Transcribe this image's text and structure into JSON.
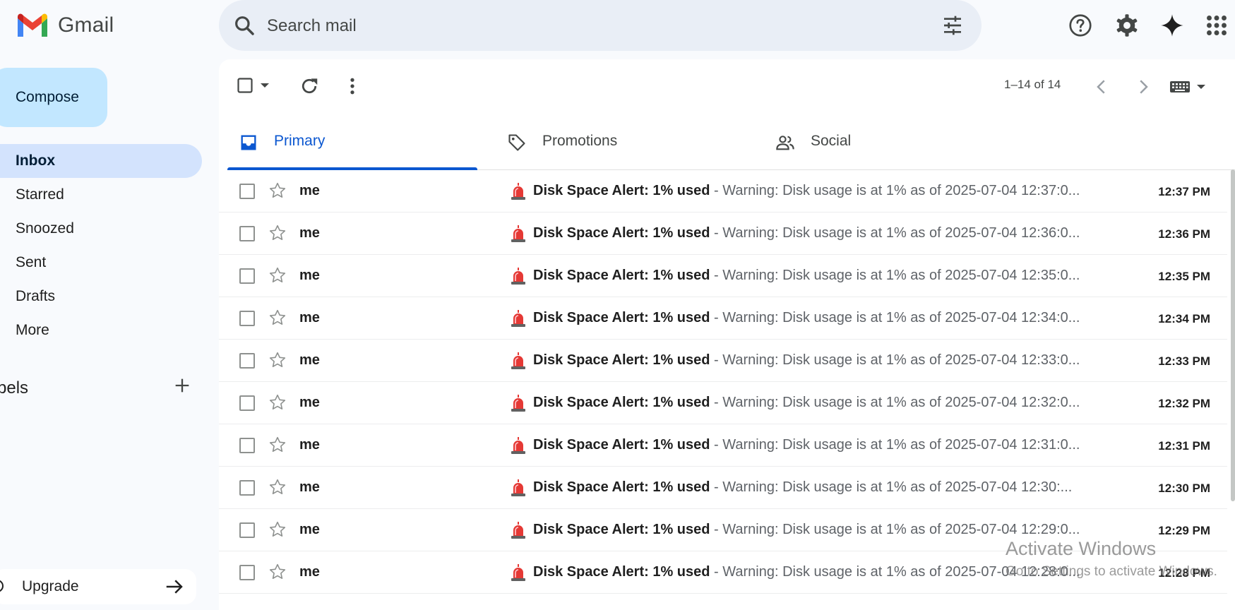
{
  "app": {
    "name": "Gmail"
  },
  "colors": {
    "accent": "#0b57d0",
    "compose_bg": "#c2e7ff",
    "active_nav_bg": "#d3e3fd",
    "siren": "#d93025"
  },
  "search": {
    "placeholder": "Search mail",
    "value": ""
  },
  "header_icons": [
    "search-icon",
    "tune-icon",
    "help-icon",
    "settings-icon",
    "gemini-icon",
    "apps-icon"
  ],
  "sidebar": {
    "compose_label": "Compose",
    "items": [
      {
        "label": "Inbox",
        "active": true
      },
      {
        "label": "Starred"
      },
      {
        "label": "Snoozed"
      },
      {
        "label": "Sent"
      },
      {
        "label": "Drafts"
      },
      {
        "label": "More"
      }
    ],
    "labels_heading": "bels",
    "upgrade_label": "Upgrade"
  },
  "toolbar": {
    "pager": "1–14 of 14"
  },
  "tabs": [
    {
      "label": "Primary",
      "active": true,
      "icon": "inbox-icon"
    },
    {
      "label": "Promotions",
      "icon": "tag-icon"
    },
    {
      "label": "Social",
      "icon": "people-icon"
    }
  ],
  "emails": [
    {
      "sender": "me",
      "subject": "Disk Space Alert: 1% used",
      "snippet": " - Warning: Disk usage is at 1% as of 2025-07-04 12:37:0...",
      "time": "12:37 PM"
    },
    {
      "sender": "me",
      "subject": "Disk Space Alert: 1% used",
      "snippet": " - Warning: Disk usage is at 1% as of 2025-07-04 12:36:0...",
      "time": "12:36 PM"
    },
    {
      "sender": "me",
      "subject": "Disk Space Alert: 1% used",
      "snippet": " - Warning: Disk usage is at 1% as of 2025-07-04 12:35:0...",
      "time": "12:35 PM"
    },
    {
      "sender": "me",
      "subject": "Disk Space Alert: 1% used",
      "snippet": " - Warning: Disk usage is at 1% as of 2025-07-04 12:34:0...",
      "time": "12:34 PM"
    },
    {
      "sender": "me",
      "subject": "Disk Space Alert: 1% used",
      "snippet": " - Warning: Disk usage is at 1% as of 2025-07-04 12:33:0...",
      "time": "12:33 PM"
    },
    {
      "sender": "me",
      "subject": "Disk Space Alert: 1% used",
      "snippet": " - Warning: Disk usage is at 1% as of 2025-07-04 12:32:0...",
      "time": "12:32 PM"
    },
    {
      "sender": "me",
      "subject": "Disk Space Alert: 1% used",
      "snippet": " - Warning: Disk usage is at 1% as of 2025-07-04 12:31:0...",
      "time": "12:31 PM"
    },
    {
      "sender": "me",
      "subject": "Disk Space Alert: 1% used",
      "snippet": " - Warning: Disk usage is at 1% as of 2025-07-04 12:30:...",
      "time": "12:30 PM"
    },
    {
      "sender": "me",
      "subject": "Disk Space Alert: 1% used",
      "snippet": " - Warning: Disk usage is at 1% as of 2025-07-04 12:29:0...",
      "time": "12:29 PM"
    },
    {
      "sender": "me",
      "subject": "Disk Space Alert: 1% used",
      "snippet": " - Warning: Disk usage is at 1% as of 2025-07-04 12:28:0...",
      "time": "12:28 PM"
    }
  ],
  "watermark": {
    "line1": "Activate Windows",
    "line2": "Go to Settings to activate Windows."
  }
}
